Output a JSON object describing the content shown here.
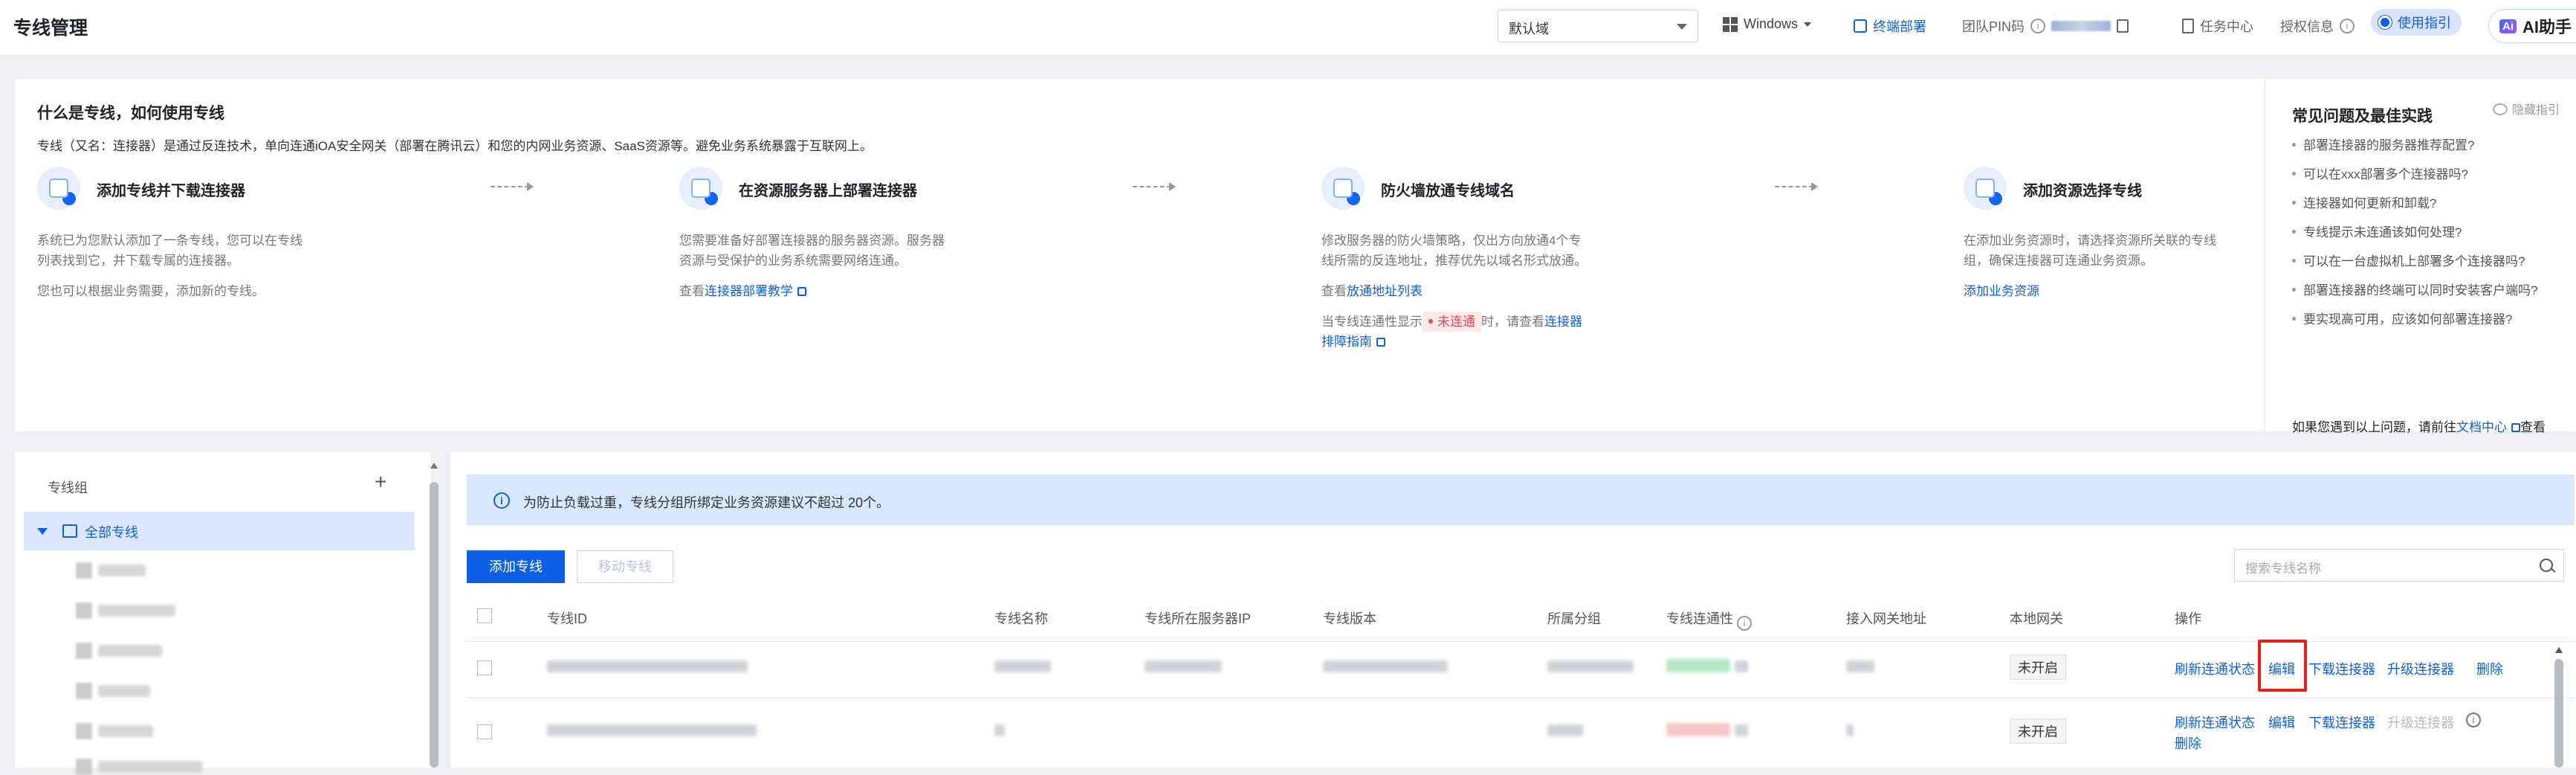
{
  "header": {
    "title": "专线管理",
    "domain_select": "默认域",
    "os": "Windows",
    "terminal_deploy": "终端部署",
    "team_pin_label": "团队PIN码",
    "task_center": "任务中心",
    "license_info": "授权信息",
    "guide": "使用指引",
    "ai_assistant": "AI助手",
    "ai_badge": "Ai"
  },
  "intro": {
    "title": "什么是专线，如何使用专线",
    "description": "专线（又名：连接器）是通过反连技术，单向连通iOA安全网关（部署在腾讯云）和您的内网业务资源、SaaS资源等。避免业务系统暴露于互联网上。",
    "steps": [
      {
        "title": "添加专线并下载连接器",
        "p1": "系统已为您默认添加了一条专线，您可以在专线列表找到它，并下载专属的连接器。",
        "p2": "您也可以根据业务需要，添加新的专线。"
      },
      {
        "title": "在资源服务器上部署连接器",
        "p1": "您需要准备好部署连接器的服务器资源。服务器资源与受保护的业务系统需要网络连通。",
        "link_prefix": "查看",
        "link": "连接器部署教学"
      },
      {
        "title": "防火墙放通专线域名",
        "p1": "修改服务器的防火墙策略，仅出方向放通4个专线所需的反连地址，推荐优先以域名形式放通。",
        "link_prefix": "查看",
        "link": "放通地址列表",
        "status_prefix": "当专线连通性显示",
        "status_tag": "未连通",
        "status_mid": "时，请查看",
        "status_link": "连接器排障指南"
      },
      {
        "title": "添加资源选择专线",
        "p1": "在添加业务资源时，请选择资源所关联的专线组，确保连接器可连通业务资源。",
        "link": "添加业务资源"
      }
    ]
  },
  "faq": {
    "title": "常见问题及最佳实践",
    "hide": "隐藏指引",
    "items": [
      "部署连接器的服务器推荐配置?",
      "可以在xxx部署多个连接器吗?",
      "连接器如何更新和卸载?",
      "专线提示未连通该如何处理?",
      "可以在一台虚拟机上部署多个连接器吗?",
      "部署连接器的终端可以同时安装客户端吗?",
      "要实现高可用，应该如何部署连接器?"
    ],
    "footer_prefix": "如果您遇到以上问题，请前往",
    "footer_link": "文档中心",
    "footer_suffix": "查看"
  },
  "groups": {
    "header": "专线组",
    "add": "+",
    "all": "全部专线"
  },
  "main": {
    "notice": "为防止负载过重，专线分组所绑定业务资源建议不超过 20个。",
    "add_button": "添加专线",
    "move_button": "移动专线",
    "search_placeholder": "搜索专线名称",
    "columns": [
      "专线ID",
      "专线名称",
      "专线所在服务器IP",
      "专线版本",
      "所属分组",
      "专线连通性",
      "接入网关地址",
      "本地网关",
      "操作"
    ],
    "rows": [
      {
        "local_gateway": "未开启",
        "actions": [
          "刷新连通状态",
          "编辑",
          "下载连接器",
          "升级连接器",
          "删除"
        ]
      },
      {
        "local_gateway": "未开启",
        "actions": [
          "刷新连通状态",
          "编辑",
          "下载连接器",
          "升级连接器",
          "删除"
        ]
      }
    ]
  }
}
